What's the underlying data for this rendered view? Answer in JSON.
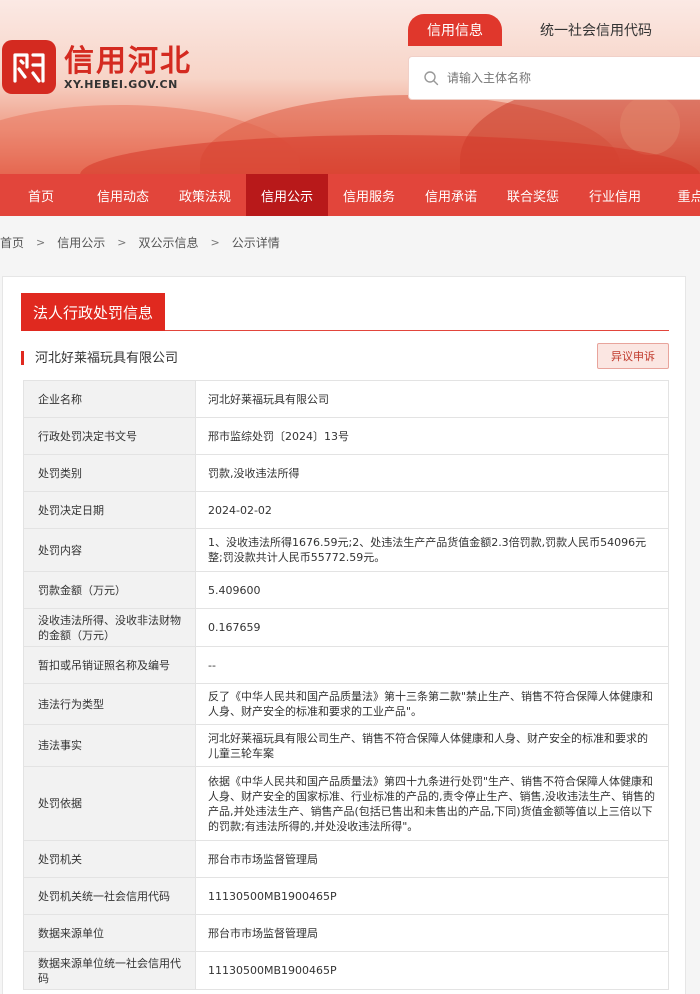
{
  "brand": {
    "title": "信用河北",
    "url": "XY.HEBEI.GOV.CN"
  },
  "search": {
    "tab_active": "信用信息",
    "tab_other": "统一社会信用代码",
    "placeholder": "请输入主体名称"
  },
  "nav": [
    {
      "label": "首页"
    },
    {
      "label": "信用动态"
    },
    {
      "label": "政策法规"
    },
    {
      "label": "信用公示"
    },
    {
      "label": "信用服务"
    },
    {
      "label": "信用承诺"
    },
    {
      "label": "联合奖惩"
    },
    {
      "label": "行业信用"
    },
    {
      "label": "重点领"
    }
  ],
  "breadcrumb": [
    "首页",
    "信用公示",
    "双公示信息",
    "公示详情"
  ],
  "section_title": "法人行政处罚信息",
  "company": "河北好莱福玩具有限公司",
  "appeal_label": "异议申诉",
  "rows": [
    {
      "k": "企业名称",
      "v": "河北好莱福玩具有限公司"
    },
    {
      "k": "行政处罚决定书文号",
      "v": "邢市监综处罚〔2024〕13号"
    },
    {
      "k": "处罚类别",
      "v": "罚款,没收违法所得"
    },
    {
      "k": "处罚决定日期",
      "v": "2024-02-02"
    },
    {
      "k": "处罚内容",
      "v": "1、没收违法所得1676.59元;2、处违法生产产品货值金额2.3倍罚款,罚款人民币54096元整;罚没款共计人民币55772.59元。"
    },
    {
      "k": "罚款金额（万元）",
      "v": "5.409600"
    },
    {
      "k": "没收违法所得、没收非法财物的金额（万元）",
      "v": "0.167659"
    },
    {
      "k": "暂扣或吊销证照名称及编号",
      "v": "--"
    },
    {
      "k": "违法行为类型",
      "v": "反了《中华人民共和国产品质量法》第十三条第二款\"禁止生产、销售不符合保障人体健康和人身、财产安全的标准和要求的工业产品\"。"
    },
    {
      "k": "违法事实",
      "v": "河北好莱福玩具有限公司生产、销售不符合保障人体健康和人身、财产安全的标准和要求的儿童三轮车案"
    },
    {
      "k": "处罚依据",
      "v": "依据《中华人民共和国产品质量法》第四十九条进行处罚\"生产、销售不符合保障人体健康和人身、财产安全的国家标准、行业标准的产品的,责令停止生产、销售,没收违法生产、销售的产品,并处违法生产、销售产品(包括已售出和未售出的产品,下同)货值金额等值以上三倍以下的罚款;有违法所得的,并处没收违法所得\"。"
    },
    {
      "k": "处罚机关",
      "v": "邢台市市场监督管理局"
    },
    {
      "k": "处罚机关统一社会信用代码",
      "v": "11130500MB1900465P"
    },
    {
      "k": "数据来源单位",
      "v": "邢台市市场监督管理局"
    },
    {
      "k": "数据来源单位统一社会信用代码",
      "v": "11130500MB1900465P"
    }
  ]
}
